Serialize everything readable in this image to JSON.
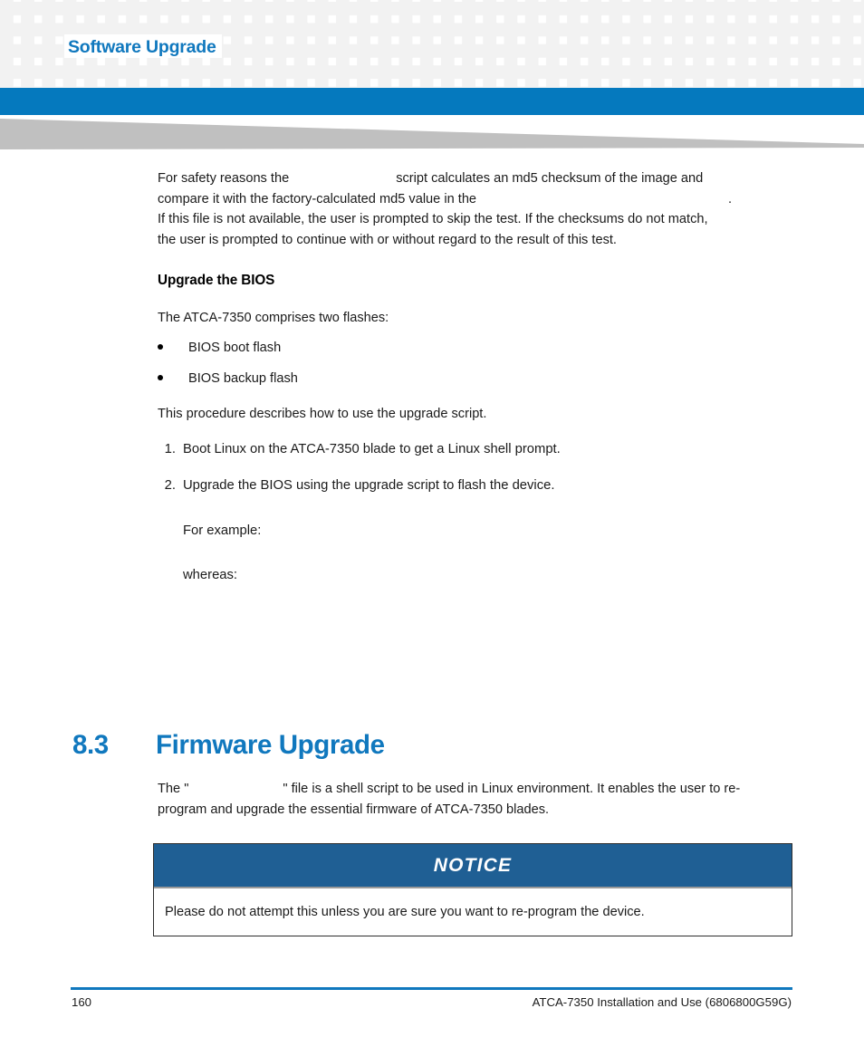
{
  "header": {
    "title": "Software Upgrade",
    "accent_color": "#1078BE",
    "banner_color": "#0579BE",
    "wedge_color": "#c0c0c0",
    "grid_square_color": "#f2f2f2"
  },
  "body": {
    "intro_paragraph": {
      "line1_before": "For safety reasons the",
      "line1_redacted": "",
      "line1_after": "script calculates an md5 checksum of the image and",
      "line2_before": "compare it with the factory-calculated md5 value in the",
      "line2_redacted": "",
      "line2_after": ".",
      "line3": "If this file is not available, the user is prompted to skip the test. If the checksums do not match,",
      "line4": "the user is prompted to continue with or without regard to the result of this test."
    },
    "subheading": "Upgrade the BIOS",
    "flashes_intro": "The ATCA-7350 comprises two flashes:",
    "bullets": [
      "BIOS boot flash",
      "BIOS backup flash"
    ],
    "procedure_intro": "This procedure describes how to use the upgrade script.",
    "steps": [
      {
        "marker": "1.",
        "text": "Boot Linux on the ATCA-7350 blade to get a Linux shell prompt."
      },
      {
        "marker": "2.",
        "text": "Upgrade the BIOS using the upgrade script to flash the device."
      }
    ],
    "example_label": "For example:",
    "whereas_label": "whereas:"
  },
  "section": {
    "number": "8.3",
    "title": "Firmware Upgrade",
    "paragraph": {
      "before": "The \"",
      "redacted": "",
      "after": "\" file is a shell script to be used in Linux environment. It enables the user to re-",
      "line2": "program and upgrade the essential firmware of ATCA-7350 blades."
    }
  },
  "notice": {
    "label": "NOTICE",
    "text": "Please do not attempt this unless you are sure you want to re-program the device.",
    "header_color": "#1F5F94"
  },
  "footer": {
    "page_number": "160",
    "document_title": "ATCA-7350 Installation and Use (6806800G59G)",
    "rule_color": "#1078BE"
  }
}
